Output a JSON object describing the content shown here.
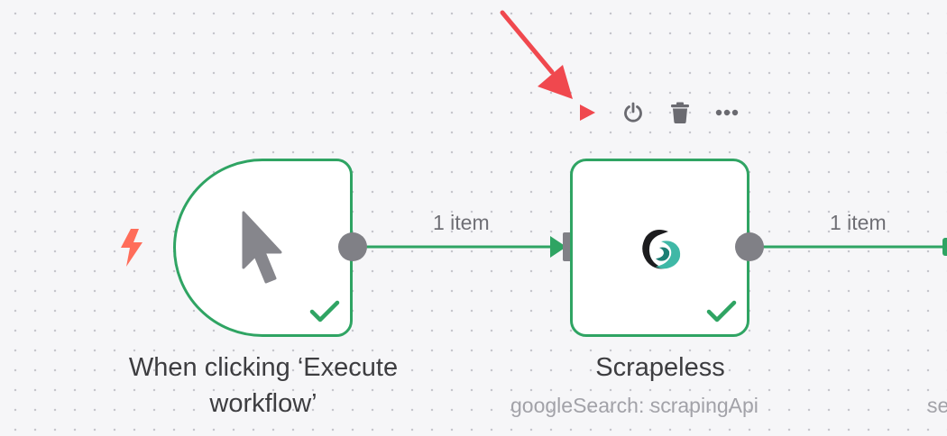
{
  "canvas": {
    "colors": {
      "background": "#f6f6f8",
      "grid_dot": "#c6c6cc",
      "success": "#2fa463",
      "handle": "#808086",
      "trigger_bolt": "#ff6d5a",
      "annotation_arrow": "#f0484e",
      "execute_play": "#f0484e"
    }
  },
  "toolbar": {
    "execute_icon": "play-icon",
    "deactivate_icon": "power-icon",
    "delete_icon": "trash-icon",
    "more_icon": "more-horizontal-icon"
  },
  "nodes": {
    "trigger": {
      "title": "When clicking ‘Execute workflow’",
      "icon": "mouse-pointer-icon",
      "trigger_icon": "lightning-bolt-icon",
      "status_icon": "checkmark-icon"
    },
    "scrapeless": {
      "title": "Scrapeless",
      "subtitle": "googleSearch: scrapingApi",
      "icon": "scrapeless-logo-icon",
      "status_icon": "checkmark-icon"
    },
    "next": {
      "subtitle_fragment": "se"
    }
  },
  "connections": [
    {
      "label": "1 item"
    },
    {
      "label": "1 item"
    }
  ]
}
